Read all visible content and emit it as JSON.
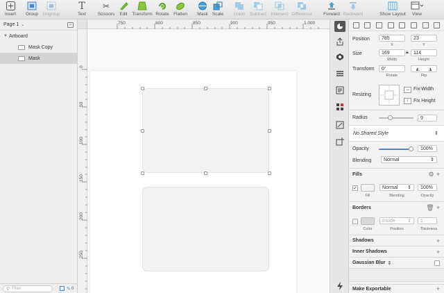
{
  "toolbar": {
    "items": [
      {
        "label": "Insert",
        "icon": "plus-icon"
      },
      {
        "label": "Group",
        "icon": "group-icon"
      },
      {
        "label": "Ungroup",
        "icon": "ungroup-icon"
      },
      {
        "label": "Text",
        "icon": "text-icon"
      },
      {
        "label": "Scissors",
        "icon": "scissors-icon"
      },
      {
        "label": "Edit",
        "icon": "edit-icon"
      },
      {
        "label": "Transform",
        "icon": "transform-icon"
      },
      {
        "label": "Rotate",
        "icon": "rotate-icon"
      },
      {
        "label": "Flatten",
        "icon": "flatten-icon"
      },
      {
        "label": "Mask",
        "icon": "mask-icon"
      },
      {
        "label": "Scale",
        "icon": "scale-icon"
      },
      {
        "label": "Union",
        "icon": "union-icon"
      },
      {
        "label": "Subtract",
        "icon": "subtract-icon"
      },
      {
        "label": "Intersect",
        "icon": "intersect-icon"
      },
      {
        "label": "Difference",
        "icon": "difference-icon"
      },
      {
        "label": "Forward",
        "icon": "forward-icon"
      },
      {
        "label": "Backward",
        "icon": "backward-icon"
      },
      {
        "label": "Show Layout",
        "icon": "layout-icon"
      },
      {
        "label": "View",
        "icon": "view-icon"
      }
    ]
  },
  "layers": {
    "page_label": "Page 1",
    "artboard_label": "Artboard",
    "items": [
      {
        "label": "Mask Copy"
      },
      {
        "label": "Mask"
      }
    ],
    "filter_placeholder": "Filter",
    "filter_count": "0"
  },
  "ruler": {
    "top": [
      "750",
      "800",
      "850",
      "900",
      "950",
      "1.000"
    ],
    "left": [
      "0",
      "50",
      "100",
      "150",
      "200",
      "250"
    ]
  },
  "inspector": {
    "position_label": "Position",
    "x": "785",
    "y": "23",
    "x_label": "X",
    "y_label": "Y",
    "size_label": "Size",
    "width": "169",
    "height": "114",
    "width_label": "Width",
    "height_label": "Height",
    "transform_label": "Transform",
    "rotate": "0°",
    "rotate_label": "Rotate",
    "flip_label": "Flip",
    "resizing_label": "Resizing",
    "fix_width": "Fix Width",
    "fix_height": "Fix Height",
    "radius_label": "Radius",
    "radius": "9",
    "radius_level": 0.3,
    "shared_style": "No Shared Style",
    "opacity_label": "Opacity",
    "opacity": "100%",
    "opacity_level": 1.0,
    "blending_label": "Blending",
    "blending": "Normal",
    "fills_label": "Fills",
    "fill_blend": "Normal",
    "fill_opacity": "100%",
    "fill_col": "Fill",
    "blend_col": "Blending",
    "opacity_col": "Opacity",
    "borders_label": "Borders",
    "border_pos": "Inside",
    "border_thick": "1",
    "color_col": "Color",
    "position_col": "Position",
    "thickness_col": "Thickness",
    "shadows": "Shadows",
    "inner_shadows": "Inner Shadows",
    "gaussian_blur": "Gaussian Blur",
    "make_exportable": "Make Exportable"
  }
}
